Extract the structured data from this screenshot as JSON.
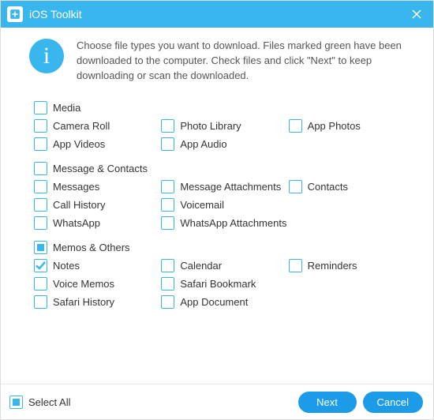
{
  "titlebar": {
    "title": "iOS Toolkit"
  },
  "intro": "Choose file types you want to download. Files marked green have been downloaded to the computer. Check files and click \"Next\" to keep downloading or scan the downloaded.",
  "groups": {
    "media": {
      "label": "Media",
      "state": "unchecked"
    },
    "messageContacts": {
      "label": "Message & Contacts",
      "state": "unchecked"
    },
    "memosOthers": {
      "label": "Memos & Others",
      "state": "indeterminate"
    }
  },
  "items": {
    "cameraRoll": {
      "label": "Camera Roll",
      "state": "unchecked"
    },
    "photoLibrary": {
      "label": "Photo Library",
      "state": "unchecked"
    },
    "appPhotos": {
      "label": "App Photos",
      "state": "unchecked"
    },
    "appVideos": {
      "label": "App Videos",
      "state": "unchecked"
    },
    "appAudio": {
      "label": "App Audio",
      "state": "unchecked"
    },
    "messages": {
      "label": "Messages",
      "state": "unchecked"
    },
    "messageAttachments": {
      "label": "Message Attachments",
      "state": "unchecked"
    },
    "contacts": {
      "label": "Contacts",
      "state": "unchecked"
    },
    "callHistory": {
      "label": "Call History",
      "state": "unchecked"
    },
    "voicemail": {
      "label": "Voicemail",
      "state": "unchecked"
    },
    "whatsapp": {
      "label": "WhatsApp",
      "state": "unchecked"
    },
    "whatsappAttachments": {
      "label": "WhatsApp Attachments",
      "state": "unchecked"
    },
    "notes": {
      "label": "Notes",
      "state": "checked"
    },
    "calendar": {
      "label": "Calendar",
      "state": "unchecked"
    },
    "reminders": {
      "label": "Reminders",
      "state": "unchecked"
    },
    "voiceMemos": {
      "label": "Voice Memos",
      "state": "unchecked"
    },
    "safariBookmark": {
      "label": "Safari Bookmark",
      "state": "unchecked"
    },
    "safariHistory": {
      "label": "Safari History",
      "state": "unchecked"
    },
    "appDocument": {
      "label": "App Document",
      "state": "unchecked"
    }
  },
  "footer": {
    "selectAll": {
      "label": "Select All",
      "state": "indeterminate"
    },
    "next": "Next",
    "cancel": "Cancel"
  }
}
